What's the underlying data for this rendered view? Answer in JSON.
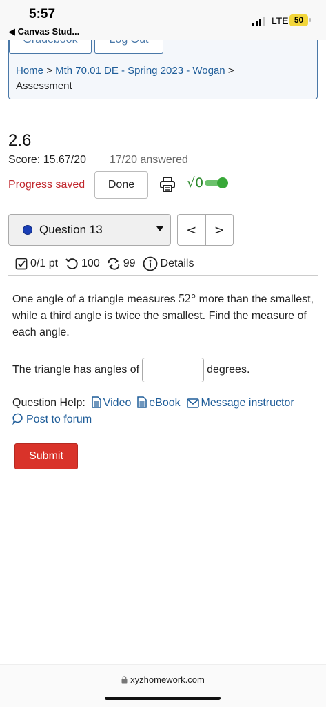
{
  "status_bar": {
    "time": "5:57",
    "back_app": "◀ Canvas Stud...",
    "network": "LTE",
    "battery": "50"
  },
  "nav": {
    "tab_left": "Gradebook",
    "tab_right": "Log Out",
    "breadcrumb": {
      "home": "Home",
      "sep": ">",
      "course": "Mth 70.01 DE - Spring 2023 - Wogan",
      "current": "Assessment"
    }
  },
  "assessment": {
    "title": "2.6",
    "score": "Score: 15.67/20",
    "answered": "17/20 answered",
    "progress": "Progress saved",
    "done_label": "Done",
    "sqrt_label": "√0"
  },
  "question_nav": {
    "selected": "Question 13",
    "prev": "<",
    "next": ">"
  },
  "stats": {
    "points": "0/1 pt",
    "retries": "100",
    "attempts": "99",
    "details": "Details"
  },
  "question": {
    "text_before": "One angle of a triangle measures ",
    "angle": "52°",
    "text_after": " more than the smallest, while a third angle is twice the smallest. Find the measure of each angle.",
    "answer_prefix": "The triangle has angles of",
    "answer_value": "",
    "answer_suffix": "degrees."
  },
  "help": {
    "label": "Question Help:",
    "video": "Video",
    "ebook": "eBook",
    "message": "Message instructor",
    "forum": "Post to forum"
  },
  "submit_label": "Submit",
  "browser": {
    "url": "xyzhomework.com"
  },
  "colors": {
    "link": "#1f5d99",
    "progress_red": "#c1272d",
    "submit_red": "#d9332a",
    "toggle_green": "#38a838",
    "question_dot": "#1a3fb5"
  }
}
